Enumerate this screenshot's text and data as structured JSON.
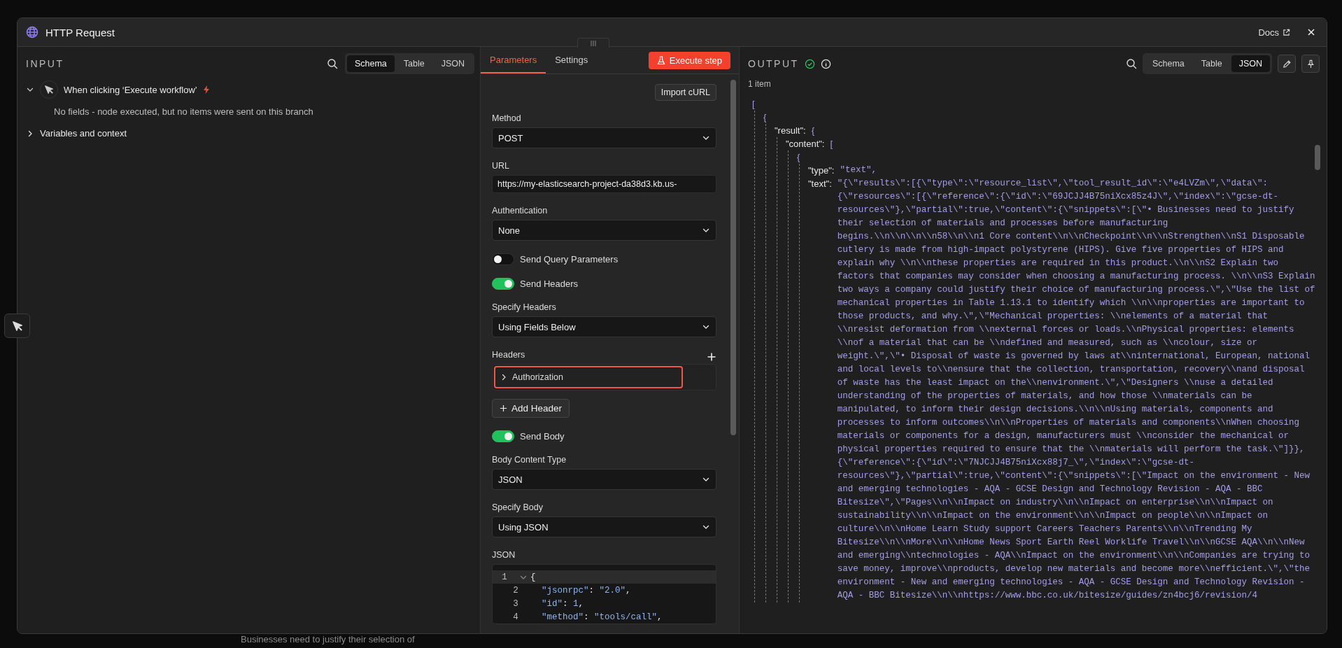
{
  "window": {
    "title": "HTTP Request",
    "docs_link": "Docs"
  },
  "canvas": {
    "note": "Businesses need to justify their selection of"
  },
  "input": {
    "title": "INPUT",
    "view_tabs": [
      {
        "label": "Schema",
        "selected": true
      },
      {
        "label": "Table",
        "selected": false
      },
      {
        "label": "JSON",
        "selected": false
      }
    ],
    "trigger": {
      "label": "When clicking ‘Execute workflow’",
      "expanded": true,
      "note": "No fields - node executed, but no items were sent on this branch"
    },
    "variables": {
      "label": "Variables and context",
      "expanded": false
    }
  },
  "parameters": {
    "tabs": [
      {
        "label": "Parameters",
        "selected": true
      },
      {
        "label": "Settings",
        "selected": false
      }
    ],
    "execute_button": "Execute step",
    "import_button": "Import cURL",
    "fields": [
      {
        "kind": "select",
        "label": "Method",
        "value": "POST"
      },
      {
        "kind": "text",
        "label": "URL",
        "value": "https://my-elasticsearch-project-da38d3.kb.us-"
      },
      {
        "kind": "select",
        "label": "Authentication",
        "value": "None"
      },
      {
        "kind": "toggle",
        "label": "Send Query Parameters",
        "on": false
      },
      {
        "kind": "toggle",
        "label": "Send Headers",
        "on": true
      },
      {
        "kind": "select",
        "label": "Specify Headers",
        "value": "Using Fields Below"
      },
      {
        "kind": "headers",
        "label": "Headers",
        "items": [
          {
            "name": "Authorization",
            "expanded": false,
            "highlighted": true
          }
        ],
        "add_button": "Add Header"
      },
      {
        "kind": "toggle",
        "label": "Send Body",
        "on": true
      },
      {
        "kind": "select",
        "label": "Body Content Type",
        "value": "JSON"
      },
      {
        "kind": "select",
        "label": "Specify Body",
        "value": "Using JSON"
      },
      {
        "kind": "code",
        "label": "JSON",
        "lines": [
          {
            "number": "1",
            "active": true,
            "foldable": true,
            "tokens": [
              {
                "kind": "punct",
                "text": "{"
              }
            ],
            "children": [
              {
                "number": "2",
                "active": false,
                "tokens": [
                  {
                    "kind": "key",
                    "text": "\"jsonrpc\""
                  },
                  {
                    "kind": "punct",
                    "text": ": "
                  },
                  {
                    "kind": "string",
                    "text": "\"2.0\""
                  },
                  {
                    "kind": "punct",
                    "text": ","
                  }
                ]
              },
              {
                "number": "3",
                "active": false,
                "tokens": [
                  {
                    "kind": "key",
                    "text": "\"id\""
                  },
                  {
                    "kind": "punct",
                    "text": ": "
                  },
                  {
                    "kind": "number",
                    "text": "1"
                  },
                  {
                    "kind": "punct",
                    "text": ","
                  }
                ]
              },
              {
                "number": "4",
                "active": false,
                "tokens": [
                  {
                    "kind": "key",
                    "text": "\"method\""
                  },
                  {
                    "kind": "punct",
                    "text": ": "
                  },
                  {
                    "kind": "string",
                    "text": "\"tools/call\""
                  },
                  {
                    "kind": "punct",
                    "text": ","
                  }
                ]
              }
            ]
          }
        ]
      }
    ]
  },
  "output": {
    "title": "OUTPUT",
    "succeeded": true,
    "view_tabs": [
      {
        "label": "Schema",
        "selected": false
      },
      {
        "label": "Table",
        "selected": false
      },
      {
        "label": "JSON",
        "selected": true
      }
    ],
    "count": "1 item",
    "json": {
      "open": "[",
      "children": [
        {
          "open": "{",
          "children": [
            {
              "key": "\"result\":",
              "open": "{",
              "children": [
                {
                  "key": "\"content\":",
                  "open": "[",
                  "children": [
                    {
                      "open": "{",
                      "children": [
                        {
                          "key": "\"type\":",
                          "value": "\"text\","
                        },
                        {
                          "key": "\"text\":",
                          "value": "\"{\\\"results\\\":[{\\\"type\\\":\\\"resource_list\\\",\\\"tool_result_id\\\":\\\"e4LVZm\\\",\\\"data\\\":{\\\"resources\\\":[{\\\"reference\\\":{\\\"id\\\":\\\"69JCJJ4B75niXcx85z4J\\\",\\\"index\\\":\\\"gcse-dt-resources\\\"},\\\"partial\\\":true,\\\"content\\\":{\\\"snippets\\\":[\\\"• Businesses need to justify their selection of materials and processes before manufacturing begins.\\\\n\\\\n\\\\n\\\\n58\\\\n\\\\n1 Core content\\\\n\\\\nCheckpoint\\\\n\\\\nStrengthen\\\\nS1 Disposable cutlery is made from high-impact polystyrene (HIPS). Give five properties of HIPS and explain why \\\\n\\\\nthese properties are required in this product.\\\\n\\\\nS2 Explain two factors that companies may consider when choosing a manufacturing process. \\\\n\\\\nS3 Explain two ways a company could justify their choice of manufacturing process.\\\",\\\"Use the list of mechanical properties in Table 1.13.1 to identify which \\\\n\\\\nproperties are important to those products, and why.\\\",\\\"Mechanical properties: \\\\nelements of a material that \\\\nresist deformation from \\\\nexternal forces or loads.\\\\nPhysical properties: elements \\\\nof a material that can be \\\\ndefined and measured, such as \\\\ncolour, size or weight.\\\",\\\"• Disposal of waste is governed by laws at\\\\ninternational, European, national and local levels to\\\\nensure that the collection, transportation, recovery\\\\nand disposal of waste has the least impact on the\\\\nenvironment.\\\",\\\"Designers \\\\nuse a detailed understanding of the properties of materials, and how those \\\\nmaterials can be manipulated, to inform their design decisions.\\\\n\\\\nUsing materials, components and processes to inform outcomes\\\\n\\\\nProperties of materials and components\\\\nWhen choosing materials or components for a design, manufacturers must \\\\nconsider the mechanical or physical properties required to ensure that the \\\\nmaterials will perform the task.\\\"]}},{\\\"reference\\\":{\\\"id\\\":\\\"7NJCJJ4B75niXcx88j7_\\\",\\\"index\\\":\\\"gcse-dt-resources\\\"},\\\"partial\\\":true,\\\"content\\\":{\\\"snippets\\\":[\\\"Impact on the environment - New and emerging technologies - AQA - GCSE Design and Technology Revision - AQA - BBC Bitesize\\\",\\\"Pages\\\\n\\\\nImpact on industry\\\\n\\\\nImpact on enterprise\\\\n\\\\nImpact on sustainability\\\\n\\\\nImpact on the environment\\\\n\\\\nImpact on people\\\\n\\\\nImpact on culture\\\\n\\\\nHome Learn Study support Careers Teachers Parents\\\\n\\\\nTrending My Bitesize\\\\n\\\\nMore\\\\n\\\\nHome News Sport Earth Reel Worklife Travel\\\\n\\\\nGCSE AQA\\\\n\\\\nNew and emerging\\\\ntechnologies - AQA\\\\nImpact on the environment\\\\n\\\\nCompanies are trying to save money, improve\\\\nproducts, develop new materials and become more\\\\nefficient.\\\",\\\"the environment - New and emerging technologies - AQA - GCSE Design and Technology Revision - AQA - BBC Bitesize\\\\n\\\\nhttps://www.bbc.co.uk/bitesize/guides/zn4bcj6/revision/4"
                        }
                      ]
                    }
                  ]
                }
              ]
            }
          ]
        }
      ]
    }
  }
}
